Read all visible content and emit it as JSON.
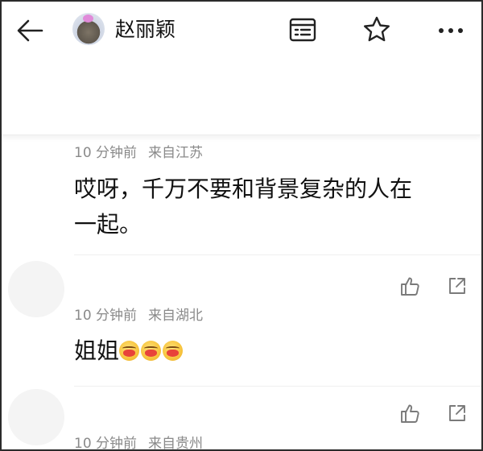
{
  "header": {
    "title": "赵丽颖",
    "icons": [
      "back-arrow-icon",
      "avatar",
      "reading-mode-icon",
      "star-icon",
      "more-icon"
    ]
  },
  "comments": [
    {
      "time": "10 分钟前",
      "location": "来自江苏",
      "text_line1": "哎呀，千万不要和背景复杂的人在",
      "text_line2": "一起。"
    },
    {
      "time": "10 分钟前",
      "location": "来自湖北",
      "text": "姐姐",
      "emoji_count": 3
    },
    {
      "time": "10 分钟前",
      "location": "来自贵州"
    }
  ],
  "colors": {
    "meta_text": "#8a8a8a",
    "body_text": "#111111",
    "icon": "#7a7a7a"
  }
}
